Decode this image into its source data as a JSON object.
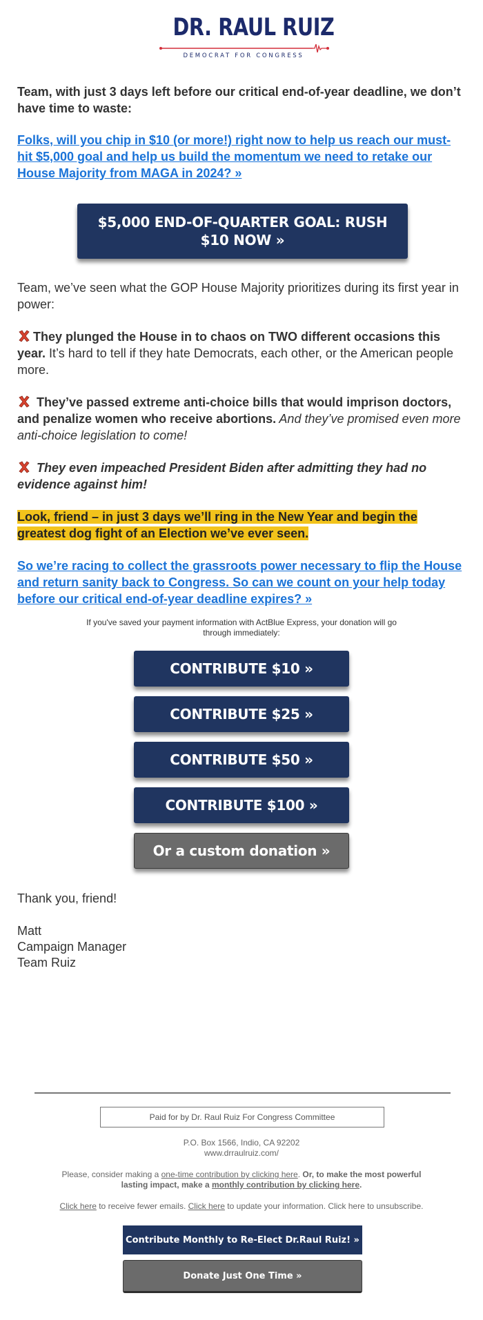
{
  "logo": {
    "name": "DR. RAUL RUIZ",
    "tagline": "DEMOCRAT FOR CONGRESS",
    "colors": {
      "navy": "#1c2a6b",
      "red": "#d32f3a"
    }
  },
  "intro": {
    "text": "Team, with just 3 days left before our critical end-of-year deadline, we don’t have time to waste:"
  },
  "link1": "Folks, will you chip in $10 (or more!) right now to help us reach our must-hit $5,000 goal and help us build the momentum we need to retake our House Majority from MAGA in 2024? »",
  "cta_big": "$5,000 END-OF-QUARTER GOAL: RUSH $10 NOW »",
  "gop_intro": "Team, we’ve seen what the GOP House Majority prioritizes during its first year in power:",
  "bullets": [
    {
      "icon": "cross-mark-icon",
      "bold": "They plunged the House in to chaos on TWO different occasions this year.",
      "rest": " It’s hard to tell if they hate Democrats, each other, or the American people more."
    },
    {
      "icon": "cross-mark-icon",
      "bold": " They’ve passed extreme anti-choice bills that would imprison doctors, and penalize women who receive abortions.",
      "rest": " And they’ve promised even more anti-choice legislation to come!"
    },
    {
      "icon": "cross-mark-icon",
      "bold": " They even impeached President Biden after admitting they had no evidence against him!",
      "rest": ""
    }
  ],
  "highlight": "Look, friend – in just 3 days we’ll ring in the New Year and begin the greatest dog fight of an Election we’ve ever seen.",
  "link2": "So we’re racing to collect the grassroots power necessary to flip the House and return sanity back to Congress. So can we count on your help today before our critical end-of-year deadline expires? »",
  "actblue_note": "If you've saved your payment information with ActBlue Express, your donation will go through immediately:",
  "donate_buttons": [
    {
      "label": "CONTRIBUTE $10 »",
      "amount": 10
    },
    {
      "label": "CONTRIBUTE $25 »",
      "amount": 25
    },
    {
      "label": "CONTRIBUTE $50 »",
      "amount": 50
    },
    {
      "label": "CONTRIBUTE $100 »",
      "amount": 100
    }
  ],
  "custom_button": "Or a custom donation »",
  "signoff": {
    "thanks": "Thank you, friend!",
    "name": "Matt",
    "title": "Campaign Manager",
    "team": "Team Ruiz"
  },
  "footer": {
    "paid_for": "Paid for by Dr. Raul Ruiz For Congress Committee",
    "address": "P.O. Box 1566, Indio, CA 92202",
    "website": "www.drraulruiz.com/",
    "consider_prefix": "Please, consider making a ",
    "one_time_link": "one-time contribution by clicking here",
    "consider_mid": ". ",
    "bold_prefix": "Or, to make the most powerful lasting impact, make a ",
    "monthly_link": "monthly contribution by clicking here",
    "bold_suffix": ".",
    "fewer_link": "Click here",
    "fewer_text": " to receive fewer emails. ",
    "update_link": "Click here",
    "update_text": " to update your information. Click here to unsubscribe.",
    "monthly_button": "Contribute Monthly to Re-Elect Dr.Raul Ruiz! »",
    "once_button": "Donate Just One Time »"
  },
  "colors": {
    "navy_button": "#203560",
    "gray_button": "#6b6b6b",
    "link": "#1a73d8",
    "highlight": "#f2c31b",
    "cross": "#d9432f"
  }
}
